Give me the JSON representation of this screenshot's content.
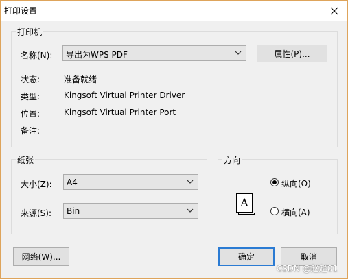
{
  "window": {
    "title": "打印设置"
  },
  "printer_group": {
    "legend": "打印机",
    "name_label": "名称(N):",
    "name_value": "导出为WPS PDF",
    "properties_button": "属性(P)...",
    "status_label": "状态:",
    "status_value": "准备就绪",
    "type_label": "类型:",
    "type_value": "Kingsoft Virtual Printer Driver",
    "location_label": "位置:",
    "location_value": "Kingsoft Virtual Printer Port",
    "comment_label": "备注:",
    "comment_value": ""
  },
  "paper_group": {
    "legend": "纸张",
    "size_label": "大小(Z):",
    "size_value": "A4",
    "source_label": "来源(S):",
    "source_value": "Bin"
  },
  "orientation_group": {
    "legend": "方向",
    "page_glyph": "A",
    "portrait_label": "纵向(O)",
    "landscape_label": "横向(A)",
    "selected": "portrait"
  },
  "footer": {
    "network_button": "网络(W)...",
    "ok_button": "确定",
    "cancel_button": "取消"
  },
  "watermark": "CSDN @赵赵01",
  "icons": {
    "close": "close-icon",
    "dropdown": "chevron-down-icon"
  }
}
